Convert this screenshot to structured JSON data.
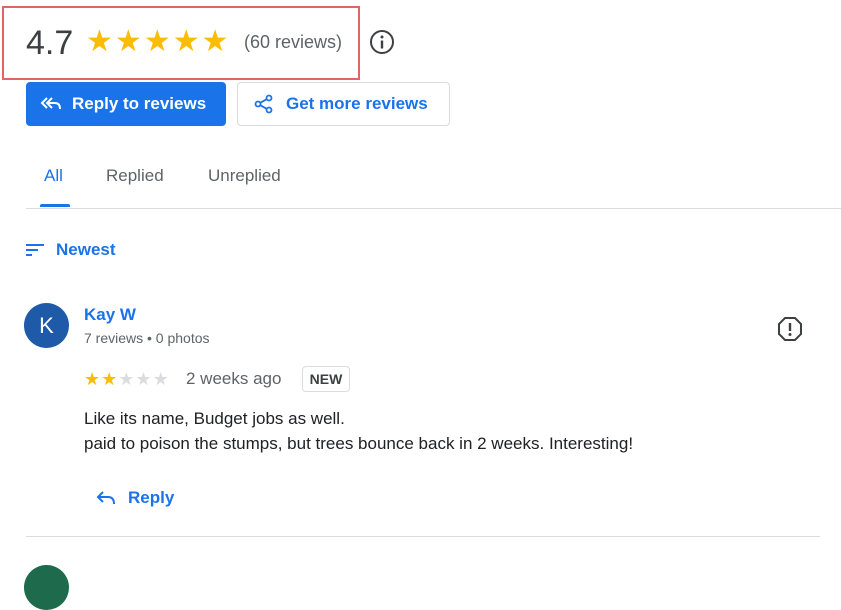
{
  "summary": {
    "rating": "4.7",
    "stars_filled": 5,
    "review_count": "(60 reviews)"
  },
  "actions": {
    "reply_label": "Reply to reviews",
    "more_label": "Get more reviews"
  },
  "tabs": [
    {
      "label": "All",
      "active": true
    },
    {
      "label": "Replied",
      "active": false
    },
    {
      "label": "Unreplied",
      "active": false
    }
  ],
  "sort": {
    "label": "Newest"
  },
  "review": {
    "avatar_letter": "K",
    "name": "Kay W",
    "meta": "7 reviews • 0 photos",
    "rating": 2,
    "time": "2 weeks ago",
    "badge": "NEW",
    "text_line1": "Like its name, Budget jobs as well.",
    "text_line2": "paid to poison the stumps, but trees bounce back in 2 weeks. Interesting!",
    "reply_label": "Reply"
  },
  "colors": {
    "accent": "#1a73e8",
    "star": "#fbbc04",
    "star_empty": "#dadce0",
    "highlight_border": "#e06666"
  }
}
